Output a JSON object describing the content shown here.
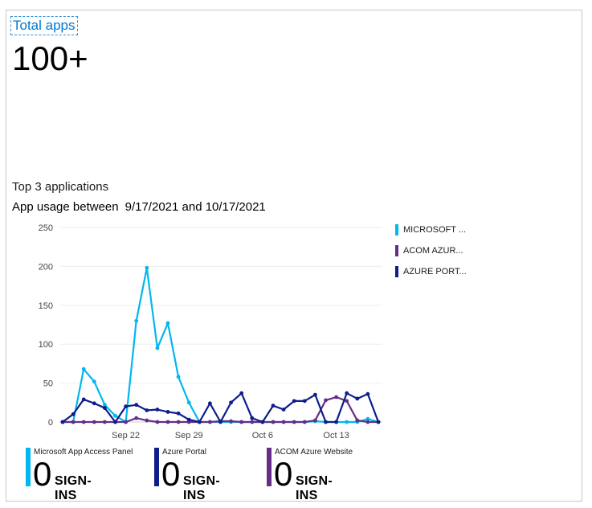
{
  "total_apps": {
    "label": "Total apps",
    "value": "100+"
  },
  "section_title": "Top 3 applications",
  "usage": {
    "prefix": "App usage between",
    "range": "9/17/2021 and 10/17/2021"
  },
  "legend": [
    {
      "label": "MICROSOFT ...",
      "color": "#00b7f0"
    },
    {
      "label": "ACOM AZUR...",
      "color": "#652d86"
    },
    {
      "label": "AZURE PORT...",
      "color": "#0e1d8a"
    }
  ],
  "stats": [
    {
      "name": "Microsoft App Access Panel",
      "count": "0",
      "unit": "SIGN-INS",
      "color": "#00b7f0"
    },
    {
      "name": "Azure Portal",
      "count": "0",
      "unit": "SIGN-INS",
      "color": "#0e1d8a"
    },
    {
      "name": "ACOM Azure Website",
      "count": "0",
      "unit": "SIGN-INS",
      "color": "#652d86"
    }
  ],
  "chart_data": {
    "type": "line",
    "x": [
      1,
      2,
      3,
      4,
      5,
      6,
      7,
      8,
      9,
      10,
      11,
      12,
      13,
      14,
      15,
      16,
      17,
      18,
      19,
      20,
      21,
      22,
      23,
      24,
      25,
      26,
      27,
      28,
      29,
      30,
      31
    ],
    "x_tick_labels": [
      {
        "x": 7,
        "label": "Sep 22"
      },
      {
        "x": 13,
        "label": "Sep 29"
      },
      {
        "x": 20,
        "label": "Oct 6"
      },
      {
        "x": 27,
        "label": "Oct 13"
      }
    ],
    "ylim": [
      0,
      250
    ],
    "yticks": [
      0,
      50,
      100,
      150,
      200,
      250
    ],
    "series": [
      {
        "name": "MICROSOFT ...",
        "color": "#00b7f0",
        "values": [
          0,
          0,
          68,
          52,
          22,
          8,
          0,
          130,
          198,
          95,
          127,
          58,
          25,
          0,
          0,
          0,
          0,
          0,
          0,
          0,
          0,
          0,
          0,
          0,
          1,
          0,
          0,
          0,
          0,
          4,
          0
        ]
      },
      {
        "name": "ACOM AZUR...",
        "color": "#652d86",
        "values": [
          0,
          0,
          0,
          0,
          0,
          0,
          0,
          5,
          2,
          0,
          0,
          0,
          0,
          0,
          0,
          1,
          1,
          0,
          0,
          0,
          0,
          0,
          0,
          0,
          2,
          28,
          32,
          27,
          2,
          0,
          0
        ]
      },
      {
        "name": "AZURE PORT...",
        "color": "#0e1d8a",
        "values": [
          0,
          10,
          29,
          24,
          18,
          0,
          20,
          22,
          15,
          16,
          13,
          11,
          3,
          0,
          24,
          0,
          25,
          37,
          5,
          0,
          21,
          16,
          27,
          27,
          35,
          0,
          0,
          37,
          30,
          36,
          0
        ]
      }
    ]
  }
}
